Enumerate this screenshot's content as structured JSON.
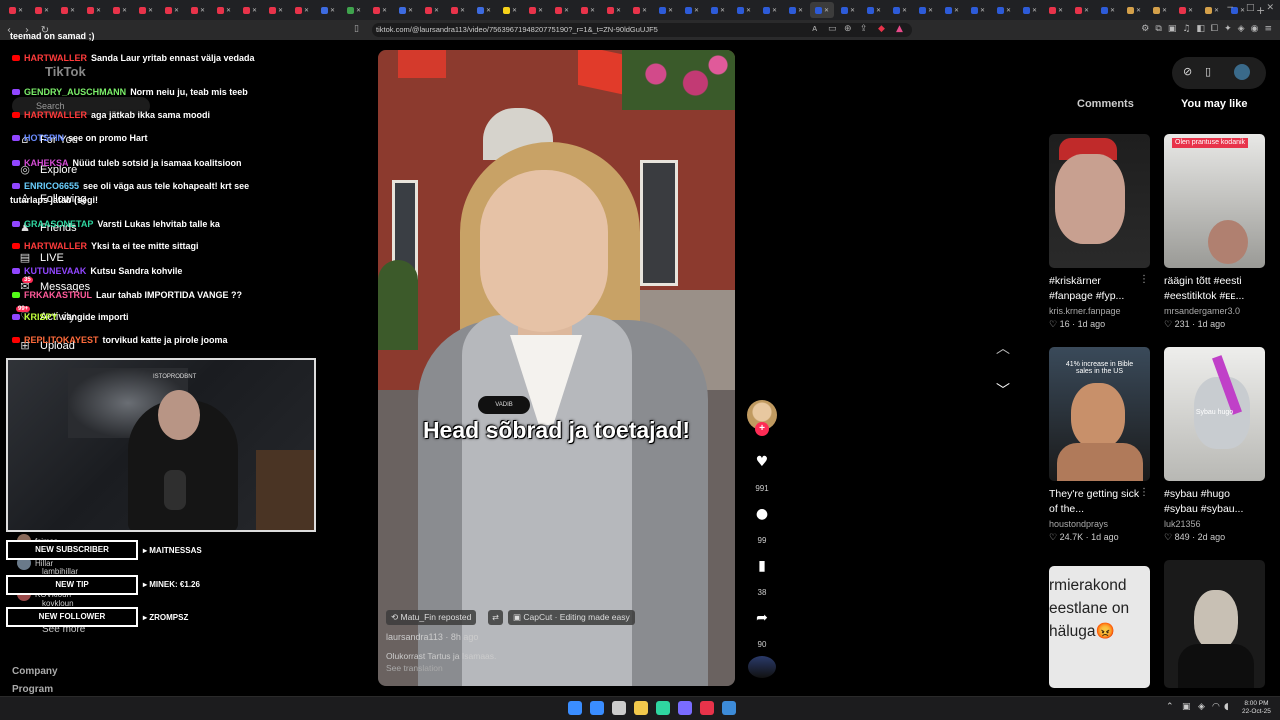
{
  "browser": {
    "url": "tiktok.com/@laursandra113/video/7563967194820775190?_r=1&_t=ZN-90ldGuUJF5",
    "tab_favicons": [
      "#e8334a",
      "#e8334a",
      "#e8334a",
      "#e8334a",
      "#e8334a",
      "#e8334a",
      "#e8334a",
      "#e8334a",
      "#e8334a",
      "#e8334a",
      "#e8334a",
      "#e8334a",
      "#3d6be0",
      "#3fa34d",
      "#e8334a",
      "#3d6be0",
      "#e8334a",
      "#e8334a",
      "#3d6be0",
      "#f6d21a",
      "#e8334a",
      "#e8334a",
      "#e8334a",
      "#e8334a",
      "#e8334a",
      "#2d5bd8",
      "#2d5bd8",
      "#2d5bd8",
      "#2d5bd8",
      "#2d5bd8",
      "#2d5bd8",
      "#2d5bd8",
      "#2d5bd8",
      "#2d5bd8",
      "#2d5bd8",
      "#2d5bd8",
      "#2d5bd8",
      "#2d5bd8",
      "#2d5bd8",
      "#2d5bd8",
      "#e8334a",
      "#e8334a",
      "#2d5bd8",
      "#d4a04a",
      "#d4a04a",
      "#e8334a",
      "#d4a04a",
      "#2d5bd8"
    ],
    "active_tab_index": 31
  },
  "sidebar": {
    "logo": "TikTok",
    "search_placeholder": "Search",
    "nav": [
      {
        "label": "For You",
        "icon": "home-icon"
      },
      {
        "label": "Explore",
        "icon": "compass-icon"
      },
      {
        "label": "Following",
        "icon": "following-icon"
      },
      {
        "label": "Friends",
        "icon": "friends-icon"
      },
      {
        "label": "LIVE",
        "icon": "live-icon"
      },
      {
        "label": "Messages",
        "icon": "messages-icon",
        "badge": "35"
      },
      {
        "label": "Activity",
        "icon": "activity-icon",
        "badge": "99+"
      },
      {
        "label": "Upload",
        "icon": "upload-icon"
      }
    ],
    "following": [
      {
        "name": "fsimsa"
      },
      {
        "name": "Hillar"
      },
      {
        "name": "lambihillar"
      },
      {
        "name": "KOVkloun"
      },
      {
        "name": "kovkloun"
      }
    ],
    "see_more": "See more",
    "footer": [
      "Company",
      "Program"
    ]
  },
  "stream_overlay": {
    "chat_header": "teemad on samad ;)",
    "chat": [
      {
        "platform": "yt",
        "user": "HARTWALLER",
        "color": "#ff3b3b",
        "msg": "Sanda Laur yritab ennast välja vedada"
      },
      {
        "platform": "tw",
        "user": "GENDRY_AUSCHMANN",
        "color": "#7cf06a",
        "msg": "Norm neiu ju, teab mis teeb"
      },
      {
        "platform": "yt",
        "user": "HARTWALLER",
        "color": "#ff3b3b",
        "msg": "aga jätkab ikka sama moodi"
      },
      {
        "platform": "tw",
        "user": "HOTSPIN",
        "color": "#6a8cff",
        "msg": "see on promo Hart"
      },
      {
        "platform": "tw",
        "user": "KAHEKSA",
        "color": "#d44cd4",
        "msg": "Nüüd tuleb sotsid ja isamaa koalitsioon"
      },
      {
        "platform": "tw",
        "user": "ENRICO6655",
        "color": "#6ad0ff",
        "msg": "see oli väga aus tele kohapealt! krt see"
      },
      {
        "platform": "tw",
        "user": "GRAASONETAP",
        "color": "#2fd6a0",
        "msg": "Varsti Lukas lehvitab talle ka"
      },
      {
        "platform": "yt",
        "user": "HARTWALLER",
        "color": "#ff3b3b",
        "msg": "Yksi ta ei tee mitte sittagi"
      },
      {
        "platform": "tw",
        "user": "KUTUNEVAAK",
        "color": "#9146ff",
        "msg": "Kutsu Sandra kohvile"
      },
      {
        "platform": "kk",
        "user": "FRKAKASTRUL",
        "color": "#ff5a9a",
        "msg": "Laur tahab IMPORTIDA VANGE ??"
      },
      {
        "platform": "tw",
        "user": "KRISPY",
        "color": "#c0ff3a",
        "msg": "vangide importi"
      },
      {
        "platform": "yt",
        "user": "REPLITOKAYEST",
        "color": "#ff6b3b",
        "msg": "torvikud katte ja pirole jooma"
      }
    ],
    "chat_continuation": "tutarlaps jätab (segi!",
    "webcam_tag": "ISTOPRODBNT",
    "alerts": [
      {
        "label": "NEW SUBSCRIBER",
        "value": "MAITNESSAS"
      },
      {
        "label": "NEW TIP",
        "value": "MINEK: €1.26"
      },
      {
        "label": "NEW FOLLOWER",
        "value": "ZROMPSZ"
      }
    ]
  },
  "video": {
    "subtitle": "Head sõbrad ja toetajad!",
    "mic_label": "VADIB",
    "reposted_by": "Matu_Fin reposted",
    "capcut": "CapCut · Editing made easy",
    "author": "laursandra113 · 8h ago",
    "description": "Olukorrast Tartus ja Isamaas.",
    "see_translation": "See translation",
    "likes": "991",
    "comments": "99",
    "saves": "38",
    "shares": "90"
  },
  "right_panel": {
    "tabs": [
      "Comments",
      "You may like"
    ],
    "active_tab": "You may like",
    "cards": [
      {
        "title": "#kriskärner #fanpage #fyp...",
        "user": "kris.krner.fanpage",
        "likes": "16",
        "age": "1d ago",
        "overlay": ""
      },
      {
        "title": "räägin tõtt #eesti #eestitiktok #ᴇᴇ...",
        "user": "mrsandergamer3.0",
        "likes": "231",
        "age": "1d ago",
        "overlay": "Olen prantuse kodanik"
      },
      {
        "title": "They're getting sick of the...",
        "user": "houstondprays",
        "likes": "24.7K",
        "age": "1d ago",
        "overlay": "41% increase in Bible sales in the US"
      },
      {
        "title": "#sybau #hugo #sybau #sybau...",
        "user": "luk21356",
        "likes": "849",
        "age": "2d ago",
        "overlay": "Sybau hugo"
      },
      {
        "title": "",
        "user": "",
        "likes": "",
        "age": "",
        "overlay": "rmierakond eestlane on häluga😡"
      },
      {
        "title": "",
        "user": "",
        "likes": "",
        "age": "",
        "overlay": ""
      }
    ]
  },
  "taskbar": {
    "time": "8:00 PM",
    "date": "22-Oct-25",
    "apps": [
      "#3a8dff",
      "#cccccc",
      "#f2c94c",
      "#2fd6a0",
      "#7a6cff",
      "#e8334a",
      "#3d8bd8"
    ]
  }
}
